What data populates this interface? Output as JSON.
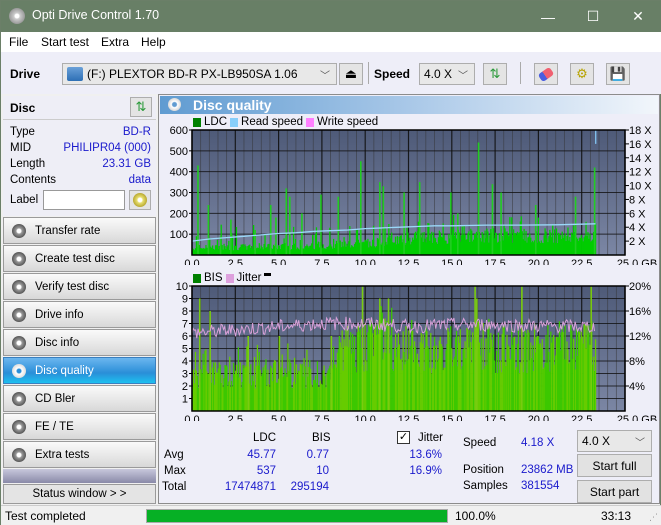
{
  "window": {
    "title": "Opti Drive Control 1.70",
    "minimize": "—",
    "maximize": "☐",
    "close": "✕"
  },
  "menu": [
    "File",
    "Start test",
    "Extra",
    "Help"
  ],
  "toolbar": {
    "drive_label": "Drive",
    "drive_value": "(F:)  PLEXTOR BD-R  PX-LB950SA 1.06",
    "speed_label": "Speed",
    "speed_value": "4.0 X"
  },
  "disc": {
    "header": "Disc",
    "rows": [
      {
        "label": "Type",
        "value": "BD-R"
      },
      {
        "label": "MID",
        "value": "PHILIPR04 (000)"
      },
      {
        "label": "Length",
        "value": "23.31 GB"
      },
      {
        "label": "Contents",
        "value": "data"
      }
    ],
    "label_field": "Label",
    "label_value": ""
  },
  "nav": [
    {
      "label": "Transfer rate",
      "active": false
    },
    {
      "label": "Create test disc",
      "active": false
    },
    {
      "label": "Verify test disc",
      "active": false
    },
    {
      "label": "Drive info",
      "active": false
    },
    {
      "label": "Disc info",
      "active": false
    },
    {
      "label": "Disc quality",
      "active": true
    },
    {
      "label": "CD Bler",
      "active": false
    },
    {
      "label": "FE / TE",
      "active": false
    },
    {
      "label": "Extra tests",
      "active": false
    }
  ],
  "status_window": "Status window > >",
  "panel_title": "Disc quality",
  "chart_data": [
    {
      "type": "bar",
      "title": "LDC / Read speed",
      "legend": [
        "LDC",
        "Read speed",
        "Write speed"
      ],
      "legend_colors": [
        "#008000",
        "#87cefa",
        "#ff80ff"
      ],
      "xlabel": "GB",
      "xlim": [
        0,
        25
      ],
      "xticks": [
        "0.0",
        "2.5",
        "5.0",
        "7.5",
        "10.0",
        "12.5",
        "15.0",
        "17.5",
        "20.0",
        "22.5",
        "25.0 GB"
      ],
      "ylim": [
        0,
        600
      ],
      "yticks": [
        "100",
        "200",
        "300",
        "400",
        "500",
        "600"
      ],
      "y2lim": [
        0,
        18
      ],
      "y2ticks": [
        "2 X",
        "4 X",
        "6 X",
        "8 X",
        "10 X",
        "12 X",
        "14 X",
        "16 X",
        "18 X"
      ],
      "data_end_gb": 23.31,
      "ldc_baseline_approx": [
        [
          0,
          35
        ],
        [
          5,
          40
        ],
        [
          10,
          55
        ],
        [
          12.5,
          80
        ],
        [
          15,
          90
        ],
        [
          20,
          95
        ],
        [
          23.3,
          95
        ]
      ],
      "ldc_peaks": [
        [
          0.3,
          430
        ],
        [
          0.9,
          240
        ],
        [
          1.6,
          90
        ],
        [
          2.2,
          170
        ],
        [
          3.6,
          120
        ],
        [
          4.5,
          240
        ],
        [
          4.8,
          180
        ],
        [
          5.4,
          320
        ],
        [
          5.6,
          280
        ],
        [
          6.3,
          200
        ],
        [
          7.4,
          290
        ],
        [
          8.4,
          280
        ],
        [
          9.7,
          450
        ],
        [
          10.8,
          350
        ],
        [
          11.0,
          330
        ],
        [
          12.2,
          300
        ],
        [
          13.1,
          350
        ],
        [
          14.9,
          300
        ],
        [
          15.3,
          200
        ],
        [
          16.5,
          540
        ],
        [
          17.3,
          340
        ],
        [
          17.8,
          300
        ],
        [
          19.8,
          240
        ],
        [
          22.1,
          280
        ],
        [
          23.2,
          420
        ]
      ],
      "read_speed_x": [
        [
          0,
          2.0
        ],
        [
          1,
          2.3
        ],
        [
          2,
          2.5
        ],
        [
          3,
          2.7
        ],
        [
          4,
          2.9
        ],
        [
          5,
          3.1
        ],
        [
          6,
          3.2
        ],
        [
          7,
          3.4
        ],
        [
          8,
          3.5
        ],
        [
          9,
          3.6
        ],
        [
          10,
          3.8
        ],
        [
          11,
          3.9
        ],
        [
          12,
          4.0
        ],
        [
          13,
          4.1
        ],
        [
          14,
          4.2
        ],
        [
          15,
          4.2
        ],
        [
          17,
          4.3
        ],
        [
          19,
          4.3
        ],
        [
          21,
          4.35
        ],
        [
          23.3,
          4.5
        ]
      ]
    },
    {
      "type": "bar",
      "title": "BIS / Jitter",
      "legend": [
        "BIS",
        "Jitter"
      ],
      "legend_colors": [
        "#008000",
        "#dda0dd"
      ],
      "xlabel": "GB",
      "xlim": [
        0,
        25
      ],
      "xticks": [
        "0.0",
        "2.5",
        "5.0",
        "7.5",
        "10.0",
        "12.5",
        "15.0",
        "17.5",
        "20.0",
        "22.5",
        "25.0 GB"
      ],
      "ylim": [
        0,
        10
      ],
      "yticks": [
        "1",
        "2",
        "3",
        "4",
        "5",
        "6",
        "7",
        "8",
        "9",
        "10"
      ],
      "y2lim": [
        0,
        20
      ],
      "y2ticks": [
        "4%",
        "8%",
        "12%",
        "16%",
        "20%"
      ],
      "data_end_gb": 23.31,
      "bis_baseline_approx": [
        [
          0,
          3
        ],
        [
          8,
          3
        ],
        [
          8.2,
          5
        ],
        [
          10.7,
          5
        ],
        [
          10.8,
          6
        ],
        [
          11.5,
          6
        ],
        [
          11.6,
          5
        ],
        [
          23.3,
          5
        ]
      ],
      "bis_peaks": [
        [
          0.4,
          9
        ],
        [
          1.0,
          8
        ],
        [
          3.2,
          6
        ],
        [
          5.0,
          6
        ],
        [
          8.0,
          6
        ],
        [
          9.8,
          10
        ],
        [
          10.8,
          9
        ],
        [
          11.3,
          9
        ],
        [
          16.3,
          10
        ],
        [
          16.4,
          9
        ],
        [
          19.0,
          10
        ],
        [
          23.0,
          10
        ]
      ],
      "jitter_pct_approx": [
        [
          0,
          12.5
        ],
        [
          2.5,
          13
        ],
        [
          5,
          13.5
        ],
        [
          7.5,
          14
        ],
        [
          10,
          14
        ],
        [
          12.5,
          13.5
        ],
        [
          15,
          13.8
        ],
        [
          17.5,
          13.8
        ],
        [
          20,
          13.6
        ],
        [
          23.3,
          13.5
        ]
      ]
    }
  ],
  "stats": {
    "col_headers": [
      "LDC",
      "BIS"
    ],
    "jitter_label": "Jitter",
    "jitter_checked": true,
    "rows": [
      {
        "label": "Avg",
        "ldc": "45.77",
        "bis": "0.77",
        "jitter": "13.6%"
      },
      {
        "label": "Max",
        "ldc": "537",
        "bis": "10",
        "jitter": "16.9%"
      },
      {
        "label": "Total",
        "ldc": "17474871",
        "bis": "295194",
        "jitter": ""
      }
    ],
    "speed_label": "Speed",
    "speed_value": "4.18 X",
    "position_label": "Position",
    "position_value": "23862 MB",
    "samples_label": "Samples",
    "samples_value": "381554",
    "speed_select": "4.0 X",
    "start_full": "Start full",
    "start_part": "Start part"
  },
  "statusbar": {
    "text": "Test completed",
    "progress": 100.0,
    "progress_text": "100.0%",
    "time": "33:13"
  }
}
